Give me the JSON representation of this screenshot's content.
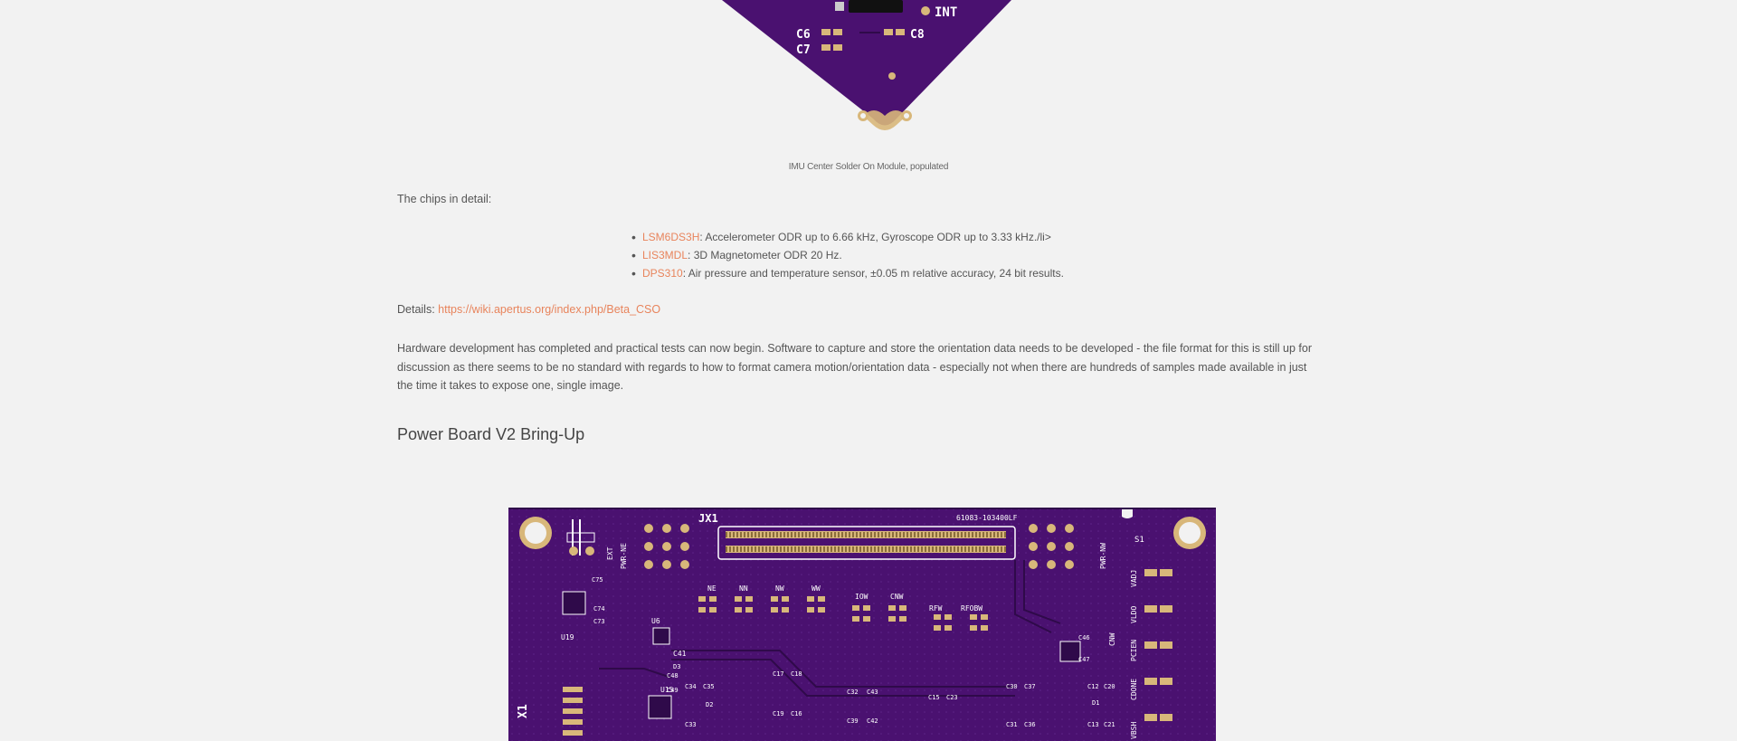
{
  "figure_top": {
    "labels": {
      "int": "INT",
      "c6": "C6",
      "c7": "C7",
      "c8": "C8"
    },
    "caption": "IMU Center Solder On Module, populated"
  },
  "chips_intro": "The chips in detail:",
  "chips": [
    {
      "name": "LSM6DS3H",
      "desc": ": Accelerometer ODR up to 6.66 kHz, Gyroscope ODR up to 3.33 kHz./li>"
    },
    {
      "name": "LIS3MDL",
      "desc": ": 3D Magnetometer ODR 20 Hz."
    },
    {
      "name": "DPS310",
      "desc": ": Air pressure and temperature sensor, ±0.05 m relative accuracy, 24 bit results."
    }
  ],
  "details": {
    "label": "Details: ",
    "link": "https://wiki.apertus.org/index.php/Beta_CSO"
  },
  "hardware_paragraph": "Hardware development has completed and practical tests can now begin. Software to capture and store the orientation data needs to be developed - the file format for this is still up for discussion as there seems to be no standard with regards to how to format camera motion/orientation data - especially not when there are hundreds of samples made available in just the time it takes to expose one, single image.",
  "section_heading": "Power Board V2 Bring-Up",
  "figure_bottom": {
    "labels": {
      "jx1": "JX1",
      "part": "61083-103400LF",
      "s1": "S1",
      "x1": "X1",
      "ext": "EXT",
      "pwr_ne": "PWR-NE",
      "pwr_nw": "PWR-NW",
      "ne": "NE",
      "nn": "NN",
      "nw": "NW",
      "ww": "WW",
      "iow": "IOW",
      "cnw": "CNW",
      "rfw": "RFW",
      "rfobw": "RFOBW",
      "u19": "U19",
      "u15": "U15",
      "u6": "U6",
      "c41": "C41",
      "d3": "D3",
      "d2": "D2",
      "c75": "C75",
      "c73": "C73",
      "c74": "C74",
      "c48": "C48",
      "c49": "C49",
      "c17": "C17",
      "c18": "C18",
      "c32": "C32",
      "c43": "C43",
      "c15": "C15",
      "c23": "C23",
      "c30": "C30",
      "c37": "C37",
      "c12": "C12",
      "c20": "C20",
      "c13": "C13",
      "c21": "C21",
      "c39": "C39",
      "c42": "C42",
      "c31": "C31",
      "c36": "C36",
      "c19": "C19",
      "c16": "C16",
      "c34": "C34",
      "c35": "C35",
      "c33": "C33",
      "d1": "D1",
      "c46": "C46",
      "c47": "C47",
      "cnw2": "CNW",
      "vldo": "VLDO",
      "pcien": "PCIEN",
      "cdone": "CDONE",
      "vbsh": "VBSH",
      "vadj": "VADJ"
    }
  },
  "colors": {
    "pcb": "#4a1170",
    "pcb_dark": "#2f0a4a",
    "pad": "#d8b77a",
    "silk": "#ffffff",
    "link": "#e8845c"
  }
}
